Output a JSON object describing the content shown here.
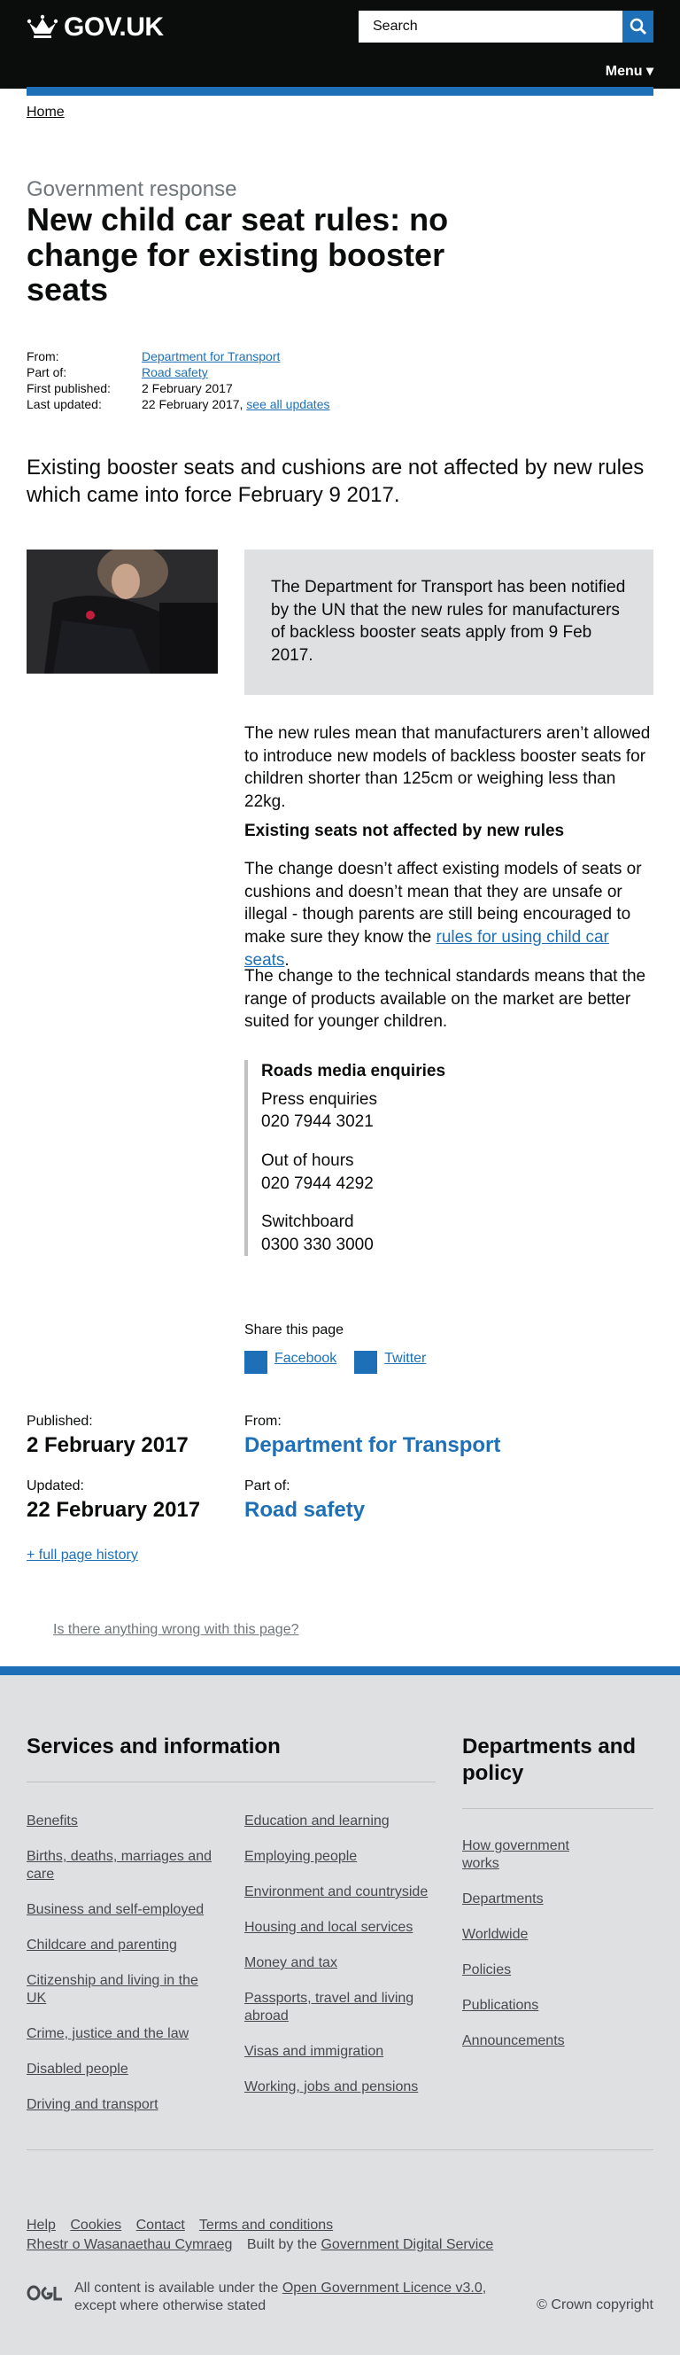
{
  "header": {
    "logo_text": "GOV.UK",
    "search_placeholder": "Search",
    "menu_label": "Menu ▾",
    "brand_color": "#1d70b8"
  },
  "breadcrumb": {
    "home": "Home"
  },
  "article": {
    "caption": "Government response",
    "title": "New child car seat rules: no change for existing booster seats",
    "meta": {
      "from_label": "From:",
      "from_value": "Department for Transport",
      "part_label": "Part of:",
      "part_value": "Road safety",
      "first_label": "First published:",
      "first_value": "2 February 2017",
      "updated_label": "Last updated:",
      "updated_value": "22 February 2017,",
      "see_updates": "see all updates"
    },
    "lede": "Existing booster seats and cushions are not affected by new rules which came into force February 9 2017.",
    "callout": "The Department for Transport has been notified by the UN that the new rules for manufacturers of backless booster seats apply from 9 Feb 2017.",
    "para1": "The new rules mean that manufacturers aren’t allowed to introduce new models of backless booster seats for children shorter than 125cm or weighing less than 22kg.",
    "subheading": "Existing seats not affected by new rules",
    "para2_before": "The change doesn’t affect existing models of seats or cushions and doesn’t mean that they are unsafe or illegal - though parents are still being encouraged to make sure they know the ",
    "para2_link": "rules for using child car seats",
    "para2_after": ".",
    "para3": "The change to the technical standards means that the range of products available on the market are better suited for younger children."
  },
  "contact": {
    "title": "Roads media enquiries",
    "items": [
      {
        "label": "Press enquiries",
        "number": "020 7944 3021"
      },
      {
        "label": "Out of hours",
        "number": "020 7944 4292"
      },
      {
        "label": "Switchboard",
        "number": "0300 330 3000"
      }
    ]
  },
  "share": {
    "title": "Share this page",
    "facebook": "Facebook",
    "twitter": "Twitter"
  },
  "published": {
    "published_label": "Published:",
    "published_value": "2 February 2017",
    "updated_label": "Updated:",
    "updated_value": "22 February 2017",
    "from_label": "From:",
    "from_value": "Department for Transport",
    "part_label": "Part of:",
    "part_value": "Road safety",
    "history": "+ full page history"
  },
  "report_link": "Is there anything wrong with this page?",
  "footer": {
    "services_title": "Services and information",
    "departments_title": "Departments and policy",
    "services_col1": [
      "Benefits",
      "Births, deaths, marriages and care",
      "Business and self-employed",
      "Childcare and parenting",
      "Citizenship and living in the UK",
      "Crime, justice and the law",
      "Disabled people",
      "Driving and transport"
    ],
    "services_col2": [
      "Education and learning",
      "Employing people",
      "Environment and countryside",
      "Housing and local services",
      "Money and tax",
      "Passports, travel and living abroad",
      "Visas and immigration",
      "Working, jobs and pensions"
    ],
    "departments": [
      "How government works",
      "Departments",
      "Worldwide",
      "Policies",
      "Publications",
      "Announcements"
    ],
    "links_row1": [
      "Help",
      "Cookies",
      "Contact",
      "Terms and conditions"
    ],
    "welsh": "Rhestr o Wasanaethau Cymraeg",
    "built_by": "Built by the",
    "gds": "Government Digital Service",
    "licence_before": "All content is available under the ",
    "licence_link": "Open Government Licence v3.0",
    "licence_after": ", except where otherwise stated",
    "copyright": "© Crown copyright"
  }
}
